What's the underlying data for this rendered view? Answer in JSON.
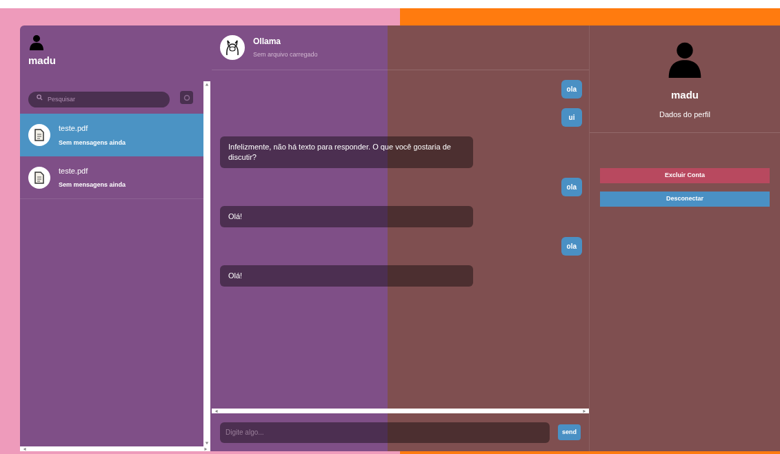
{
  "sidebar": {
    "user": {
      "name": "madu"
    },
    "search": {
      "placeholder": "Pesquisar"
    },
    "conversations": [
      {
        "title": "teste.pdf",
        "subtitle": "Sem mensagens ainda",
        "selected": true
      },
      {
        "title": "teste.pdf",
        "subtitle": "Sem mensagens ainda",
        "selected": false
      }
    ]
  },
  "chat": {
    "header": {
      "title": "Ollama",
      "subtitle": "Sem arquivo carregado"
    },
    "messages": [
      {
        "kind": "user",
        "text": "ola"
      },
      {
        "kind": "user",
        "text": "ui"
      },
      {
        "kind": "bot",
        "text": "Infelizmente, não há texto para responder. O que você gostaria de discutir?"
      },
      {
        "kind": "user",
        "text": "ola"
      },
      {
        "kind": "bot",
        "text": "Olá!"
      },
      {
        "kind": "user",
        "text": "ola"
      },
      {
        "kind": "bot",
        "text": "Olá!"
      }
    ],
    "input": {
      "placeholder": "Digite algo..."
    },
    "send_button": "send"
  },
  "profile": {
    "name": "madu",
    "subtitle": "Dados do perfil",
    "buttons": [
      {
        "label": "Excluir Conta",
        "kind": "danger"
      },
      {
        "label": "Desconectar",
        "kind": "primary"
      }
    ]
  }
}
